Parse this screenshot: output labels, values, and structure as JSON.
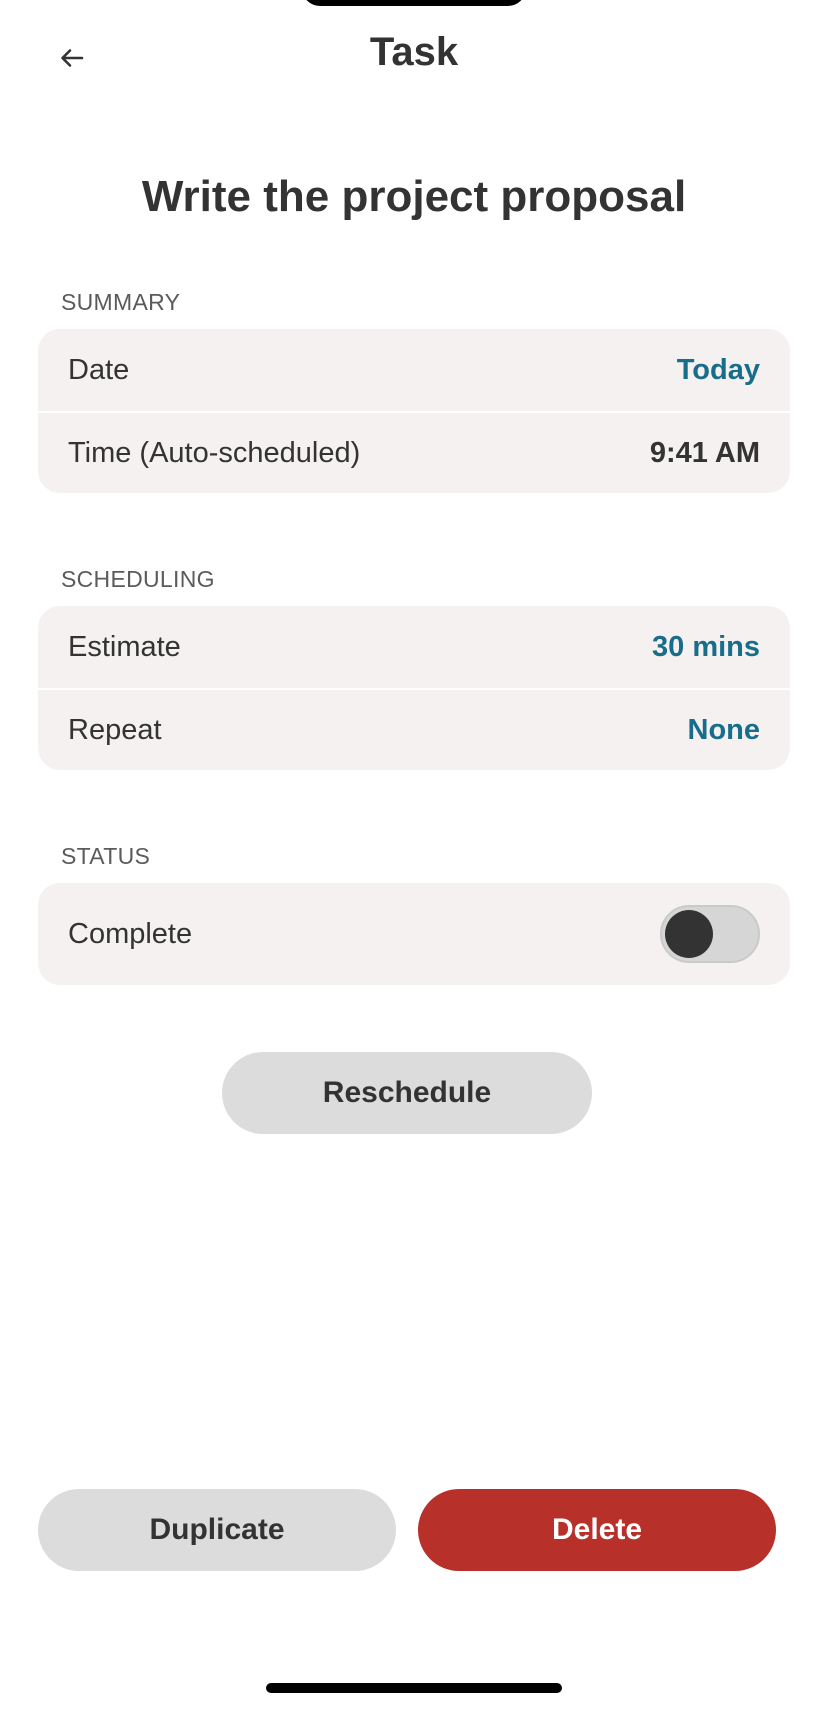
{
  "nav": {
    "title": "Task",
    "back_icon": "arrow-left-icon"
  },
  "task": {
    "title": "Write the project proposal"
  },
  "summary": {
    "section_label": "SUMMARY",
    "date_label": "Date",
    "date_value": "Today",
    "time_label": "Time (Auto-scheduled)",
    "time_value": "9:41 AM"
  },
  "scheduling": {
    "section_label": "SCHEDULING",
    "estimate_label": "Estimate",
    "estimate_value": "30 mins",
    "repeat_label": "Repeat",
    "repeat_value": "None"
  },
  "status": {
    "section_label": "STATUS",
    "complete_label": "Complete",
    "complete_on": false
  },
  "actions": {
    "reschedule_label": "Reschedule",
    "duplicate_label": "Duplicate",
    "delete_label": "Delete"
  },
  "colors": {
    "accent": "#176d8a",
    "danger": "#b8302a",
    "card_bg": "#f4f1f0",
    "button_gray": "#dcdcdc",
    "text": "#333333"
  }
}
